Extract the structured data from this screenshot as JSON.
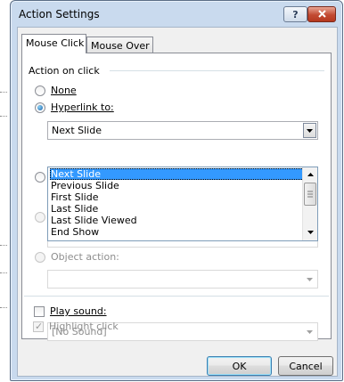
{
  "window": {
    "title": "Action Settings",
    "help_label": "?",
    "close_label": "x"
  },
  "tabs": [
    {
      "label": "Mouse Click",
      "active": true
    },
    {
      "label": "Mouse Over",
      "active": false
    }
  ],
  "action_group": {
    "label": "Action on click",
    "options": {
      "none": {
        "label": "None",
        "checked": false
      },
      "hyperlink": {
        "label": "Hyperlink to:",
        "checked": true,
        "value": "Next Slide"
      },
      "object_action": {
        "label": "Object action:",
        "checked": false,
        "value": ""
      }
    }
  },
  "hyperlink_list": {
    "items": [
      "Next Slide",
      "Previous Slide",
      "First Slide",
      "Last Slide",
      "Last Slide Viewed",
      "End Show"
    ],
    "selected": "Next Slide"
  },
  "sound": {
    "label": "Play sound:",
    "checked": false,
    "value": "[No Sound]"
  },
  "highlight": {
    "label": "Highlight click",
    "checked": true
  },
  "buttons": {
    "ok": "OK",
    "cancel": "Cancel"
  },
  "colors": {
    "frame": "#c9daee",
    "selection": "#3399ff",
    "close": "#c24a32"
  }
}
